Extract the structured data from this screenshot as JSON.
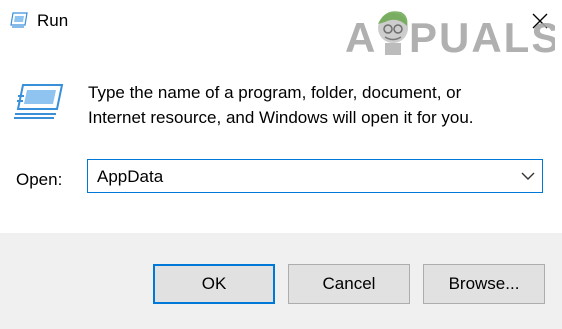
{
  "window": {
    "title": "Run"
  },
  "watermark": {
    "text": "APPUALS",
    "letters_left": "A",
    "letters_right": "PUALS"
  },
  "prompt": {
    "line1": "Type the name of a program, folder, document, or",
    "line2": "Internet resource, and Windows will open it for you."
  },
  "open_field": {
    "label": "Open:",
    "value": "AppData"
  },
  "buttons": {
    "ok": "OK",
    "cancel": "Cancel",
    "browse": "Browse..."
  },
  "colors": {
    "accent": "#0078d7",
    "footer_bg": "#f0f0f0",
    "button_bg": "#e1e1e1",
    "button_border": "#adadad"
  },
  "icons": {
    "title": "run-app-icon",
    "main": "run-app-icon",
    "close": "close-icon",
    "dropdown": "chevron-down-icon"
  }
}
